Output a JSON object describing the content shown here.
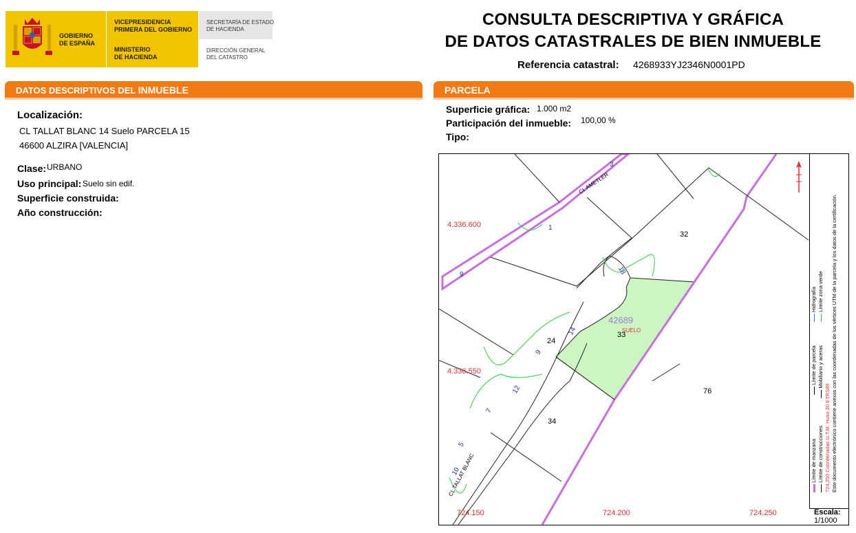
{
  "header": {
    "gov_line1": "GOBIERNO",
    "gov_line2": "DE ESPAÑA",
    "vice_line1": "VICEPRESIDENCIA",
    "vice_line2": "PRIMERA DEL GOBIERNO",
    "min_line1": "MINISTERIO",
    "min_line2": "DE HACIENDA",
    "sec_line1": "SECRETARÍA DE ESTADO",
    "sec_line2": "DE HACIENDA",
    "dir_line1": "DIRECCIÓN GENERAL",
    "dir_line2": "DEL CATASTRO",
    "title_line1": "CONSULTA DESCRIPTIVA Y GRÁFICA",
    "title_line2": "DE DATOS CATASTRALES DE BIEN INMUEBLE",
    "ref_label": "Referencia catastral:",
    "ref_value": "4268933YJ2346N0001PD"
  },
  "left": {
    "bar_title_a": "DATOS DESCRIPTIVOS DEL ",
    "bar_title_b": "INMUEBLE",
    "loc_label": "Localización:",
    "loc_line1": "CL TALLAT BLANC 14 Suelo PARCELA 15",
    "loc_line2": "46600 ALZIRA [VALENCIA]",
    "clase_label": "Clase:",
    "clase_value": "URBANO",
    "uso_label": "Uso principal:",
    "uso_value": "Suelo sin edif.",
    "sup_label": "Superficie construida:",
    "anio_label": "Año construcción:"
  },
  "right": {
    "bar_title": "PARCELA",
    "sup_label": "Superficie gráfica:",
    "sup_value": "1.000 m2",
    "part_label": "Participación del inmueble:",
    "part_value": "100,00 %",
    "tipo_label": "Tipo:"
  },
  "map": {
    "coord_y1": "4.336.600",
    "coord_y2": "4.336.550",
    "coord_x1": "724.150",
    "coord_x2": "724.200",
    "coord_x3": "724.250",
    "parcel_id": "42689",
    "parcel_type": "SUELO",
    "n32": "32",
    "n33": "33",
    "n24": "24",
    "n34": "34",
    "n76": "76",
    "street1": "CL AMETLER",
    "street2": "CL TALLAT BLANC",
    "num1": "1",
    "num3": "3",
    "num9a": "9",
    "num18": "18",
    "num14": "14",
    "num9b": "9",
    "num12": "12",
    "num7": "7",
    "num5": "5",
    "num10": "10",
    "legend1": "Límite de manzana",
    "legend2": "Límite de parcela",
    "legend3": "Hidrografía",
    "legend4": "Límite de construcciones",
    "legend5": "Mobiliario y aceras",
    "legend6": "Límite zona verde",
    "legend7": "Este documento electrónico contiene anexos con las coordenadas de los vértices UTM de la parcela y los datos de la certificación.",
    "legend8": "Coordenadas U.T.M. Huso 30 ETRS89",
    "legend8_num": "724.250",
    "escala_label": "Escala:",
    "escala_value": "1/1000"
  },
  "colors": {
    "orange": "#f07a13",
    "yellow": "#f2c400",
    "parcel_fill": "#cdf5c2",
    "block_line": "#c86ee0",
    "green_line": "#2ecc40",
    "coord_red": "#e03030"
  }
}
